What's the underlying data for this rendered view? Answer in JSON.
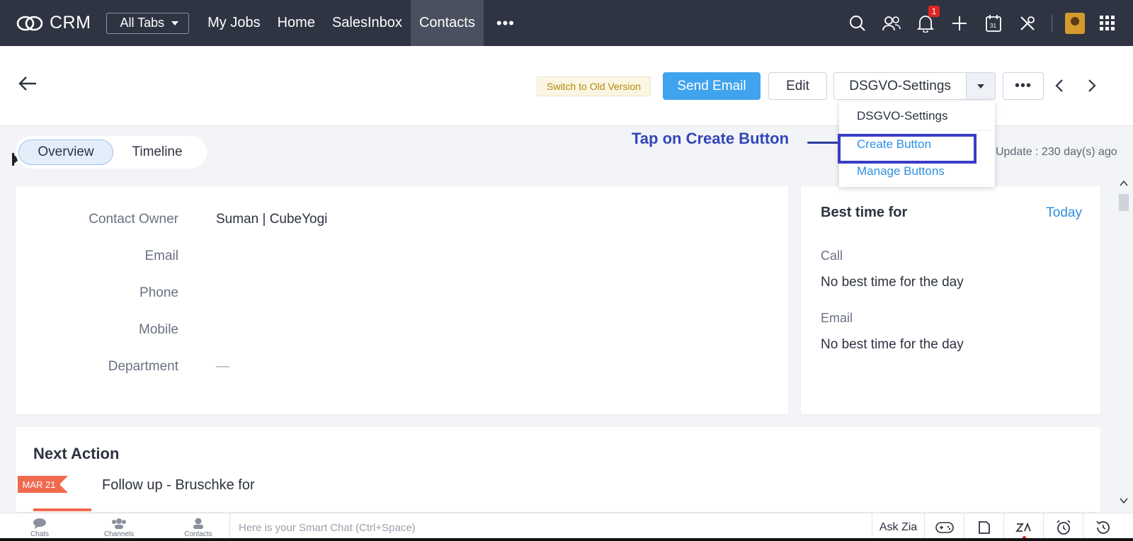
{
  "nav": {
    "app_name": "CRM",
    "all_tabs": "All Tabs",
    "links": [
      "My Jobs",
      "Home",
      "SalesInbox",
      "Contacts"
    ],
    "active_link": "Contacts",
    "more": "•••",
    "notification_count": "1",
    "icons": [
      "search-icon",
      "users-icon",
      "bell-icon",
      "plus-icon",
      "calendar-icon",
      "tools-icon",
      "avatar",
      "apps-grid-icon"
    ]
  },
  "header": {
    "switch_old": "Switch to Old Version",
    "send_email": "Send Email",
    "edit": "Edit",
    "dsgvo": "DSGVO-Settings",
    "more": "•••"
  },
  "dropdown": {
    "items": [
      "DSGVO-Settings",
      "Create Button",
      "Manage Buttons"
    ]
  },
  "annotation": {
    "text": "Tap on Create Button"
  },
  "tabs": {
    "overview": "Overview",
    "timeline": "Timeline"
  },
  "last_update": "Update : 230 day(s) ago",
  "fields": [
    {
      "label": "Contact Owner",
      "value": "Suman | CubeYogi"
    },
    {
      "label": "Email",
      "value": ""
    },
    {
      "label": "Phone",
      "value": ""
    },
    {
      "label": "Mobile",
      "value": ""
    },
    {
      "label": "Department",
      "value": "—"
    }
  ],
  "best_time": {
    "title": "Best time for",
    "today": "Today",
    "call_label": "Call",
    "call_value": "No best time for the day",
    "email_label": "Email",
    "email_value": "No best time for the day"
  },
  "next_action": {
    "title": "Next Action",
    "date_tag": "MAR 21",
    "item": "Follow up - Bruschke for"
  },
  "bottom": {
    "chats": "Chats",
    "channels": "Channels",
    "contacts": "Contacts",
    "smart_chat_placeholder": "Here is your Smart Chat (Ctrl+Space)",
    "ask_zia": "Ask Zia"
  },
  "colors": {
    "nav_bg": "#2f3442",
    "accent_blue": "#40a3ee",
    "link_blue": "#2f8ee0",
    "annotation": "#3346b8",
    "tag_red": "#f06a4e"
  }
}
